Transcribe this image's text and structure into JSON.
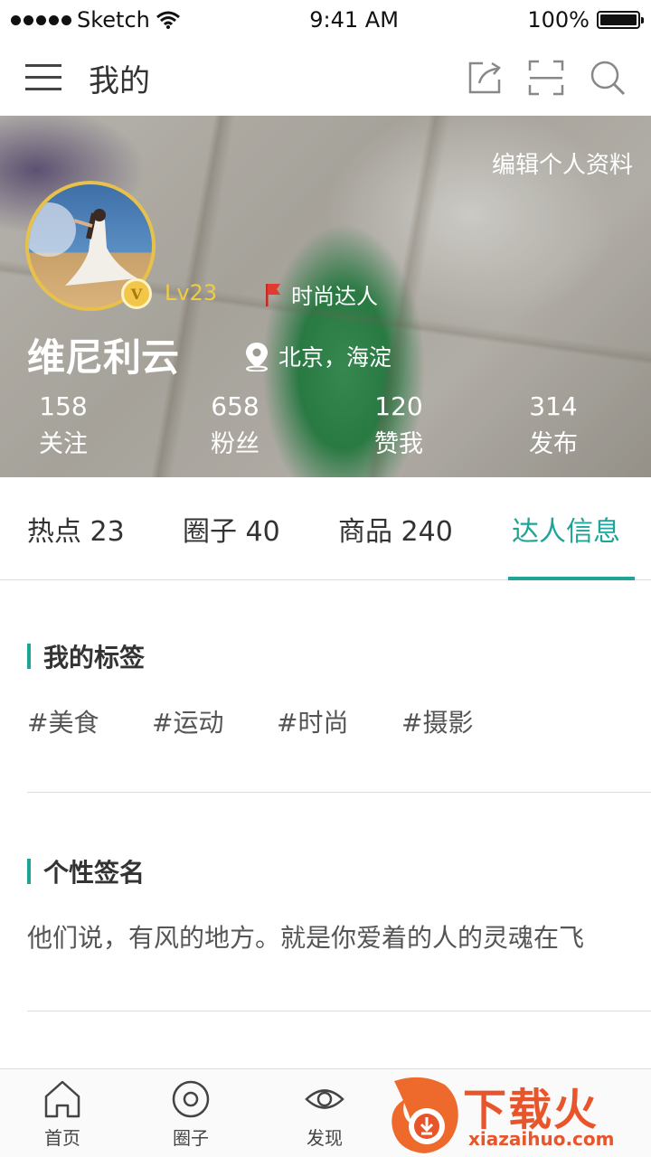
{
  "status_bar": {
    "carrier": "Sketch",
    "time": "9:41 AM",
    "battery": "100%"
  },
  "nav": {
    "title": "我的"
  },
  "profile": {
    "edit_label": "编辑个人资料",
    "level": "Lv23",
    "badge_letter": "V",
    "talent_label": "时尚达人",
    "name": "维尼利云",
    "location": "北京，海淀",
    "stats": [
      {
        "value": "158",
        "label": "关注"
      },
      {
        "value": "658",
        "label": "粉丝"
      },
      {
        "value": "120",
        "label": "赞我"
      },
      {
        "value": "314",
        "label": "发布"
      }
    ]
  },
  "tabs": [
    {
      "label": "热点 23"
    },
    {
      "label": "圈子 40"
    },
    {
      "label": "商品 240"
    },
    {
      "label": "达人信息",
      "active": true
    }
  ],
  "tags_section": {
    "title": "我的标签",
    "tags": [
      "#美食",
      "#运动",
      "#时尚",
      "#摄影"
    ]
  },
  "signature_section": {
    "title": "个性签名",
    "text": "他们说，有风的地方。就是你爱着的人的灵魂在飞"
  },
  "bottom_tabs": [
    {
      "label": "首页",
      "icon": "home-icon"
    },
    {
      "label": "圈子",
      "icon": "circle-icon"
    },
    {
      "label": "发现",
      "icon": "eye-icon"
    }
  ],
  "watermark": {
    "title": "下载火",
    "url": "xiazaihuo.com"
  },
  "colors": {
    "accent": "#1fa49a",
    "gold": "#f1cc40",
    "flag": "#e23a2e"
  }
}
